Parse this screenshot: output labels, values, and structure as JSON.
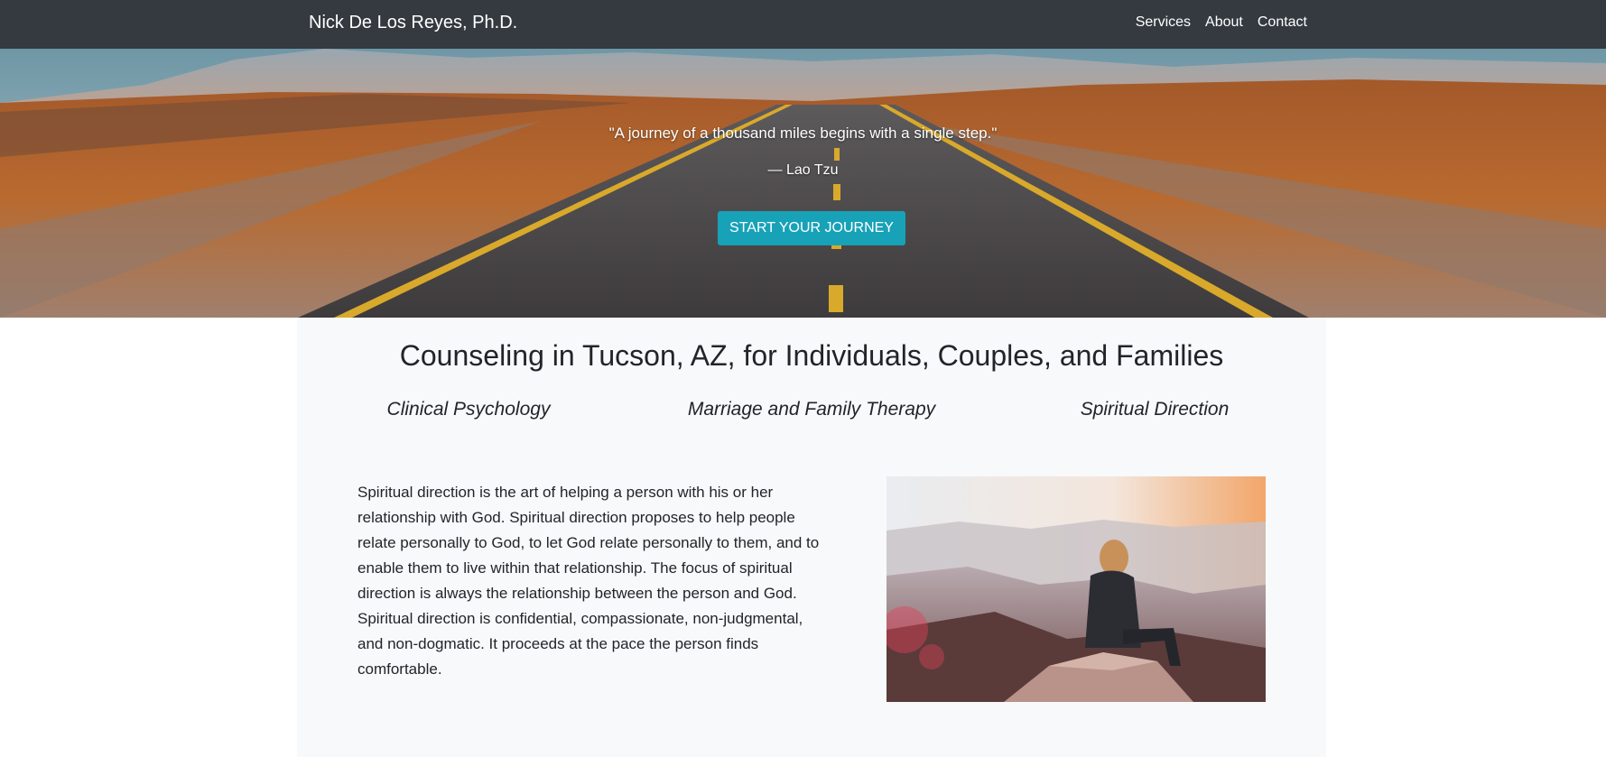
{
  "navbar": {
    "brand": "Nick De Los Reyes, Ph.D.",
    "links": [
      "Services",
      "About",
      "Contact"
    ]
  },
  "hero": {
    "quote": "\"A journey of a thousand miles begins with a single step.\"",
    "author": "— Lao Tzu",
    "cta_label": "Start Your Journey"
  },
  "main": {
    "headline": "Counseling in Tucson, AZ, for Individuals, Couples, and Families",
    "services": [
      "Clinical Psychology",
      "Marriage and Family Therapy",
      "Spiritual Direction"
    ],
    "body": "Spiritual direction is the art of helping a person with his or her relationship with God. Spiritual direction proposes to help people relate personally to God, to let God relate personally to them, and to enable them to live within that relationship. The focus of spiritual direction is always the relationship between the person and God. Spiritual direction is confidential, compassionate, non-judgmental, and non-dogmatic. It proceeds at the pace the person finds comfortable."
  },
  "colors": {
    "navbar_bg": "#343a40",
    "cta_bg": "#17a2b8",
    "section_bg": "#f8f9fa",
    "text": "#212529"
  }
}
